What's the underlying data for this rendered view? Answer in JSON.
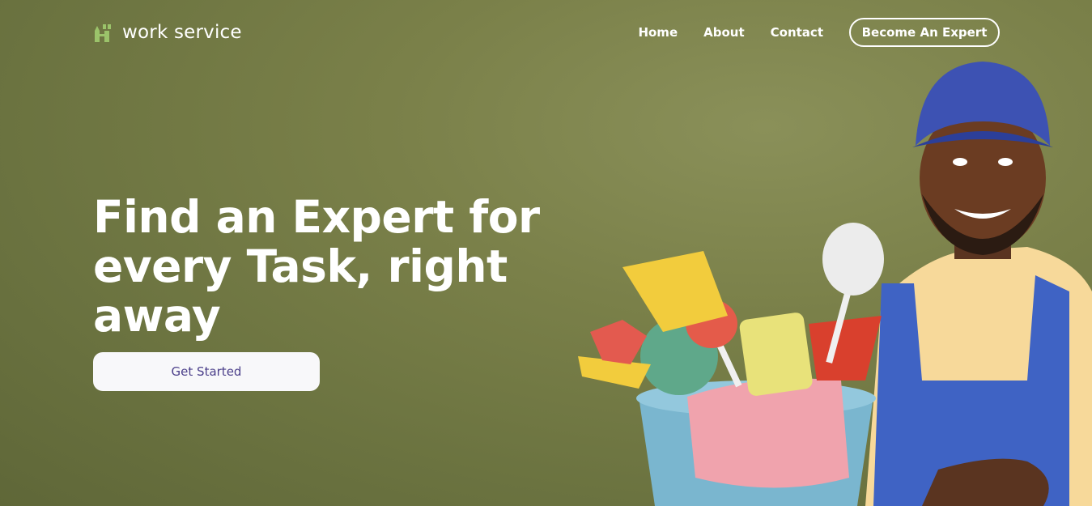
{
  "brand": {
    "name": "work service",
    "accent": "#9bc36a"
  },
  "nav": {
    "home": "Home",
    "about": "About",
    "contact": "Contact",
    "become_expert": "Become An Expert"
  },
  "hero": {
    "headline_line1": "Find an Expert for",
    "headline_line2": "every Task, right",
    "headline_line3": "away",
    "cta": "Get Started"
  },
  "colors": {
    "background": "#747b45",
    "cta_text": "#4b3f8a",
    "cta_bg": "#f8f8fa"
  },
  "icons": [
    "tools-logo-icon"
  ]
}
